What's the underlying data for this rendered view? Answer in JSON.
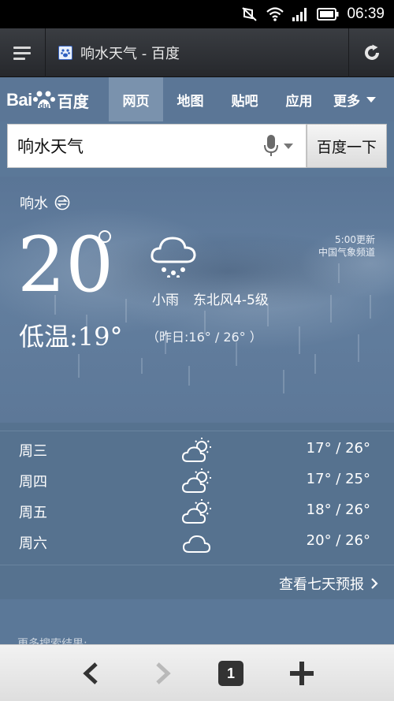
{
  "status_bar": {
    "time": "06:39"
  },
  "browser": {
    "tab_title": "响水天气 - 百度",
    "open_tabs": "1"
  },
  "baidu": {
    "logo_bai": "Bai",
    "logo_du": "百度",
    "nav": [
      {
        "label": "网页",
        "active": true
      },
      {
        "label": "地图",
        "active": false
      },
      {
        "label": "贴吧",
        "active": false
      },
      {
        "label": "应用",
        "active": false
      },
      {
        "label": "更多",
        "active": false
      }
    ],
    "search": {
      "query": "响水天气",
      "button": "百度一下"
    }
  },
  "weather": {
    "city": "响水",
    "temperature": "20",
    "low": "低温:19°",
    "condition": "小雨",
    "wind": "东北风4-5级",
    "yesterday": "（昨日:16° / 26° ）",
    "update_time": "5:00更新",
    "source": "中国气象频道",
    "forecast": [
      {
        "day": "周三",
        "icon": "partly-cloudy-icon",
        "range": "17° / 26°"
      },
      {
        "day": "周四",
        "icon": "partly-cloudy-icon",
        "range": "17° / 25°"
      },
      {
        "day": "周五",
        "icon": "partly-cloudy-icon",
        "range": "18° / 26°"
      },
      {
        "day": "周六",
        "icon": "cloudy-icon",
        "range": "20° / 26°"
      }
    ],
    "seven_day_link": "查看七天预报"
  },
  "more_results": "更多搜索结果: "
}
